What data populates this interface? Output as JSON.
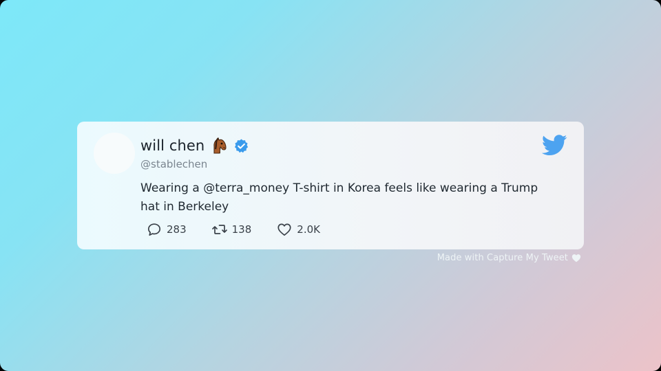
{
  "tweet": {
    "display_name": "will chen",
    "handle": "@stablechen",
    "text": "Wearing a @terra_money T-shirt in Korea feels like wearing a Trump hat in Berkeley",
    "name_emoji": "horse-face",
    "verified": true,
    "brand_icon": "twitter-bird-icon",
    "stats": {
      "replies": "283",
      "retweets": "138",
      "likes": "2.0K"
    }
  },
  "footer": {
    "credit": "Made with Capture My Tweet",
    "credit_icon": "heart-icon"
  },
  "colors": {
    "twitter_blue": "#4da3f0",
    "verified_blue": "#3a9bec",
    "background_start": "#7de8f9",
    "background_end": "#ecc3c9"
  }
}
